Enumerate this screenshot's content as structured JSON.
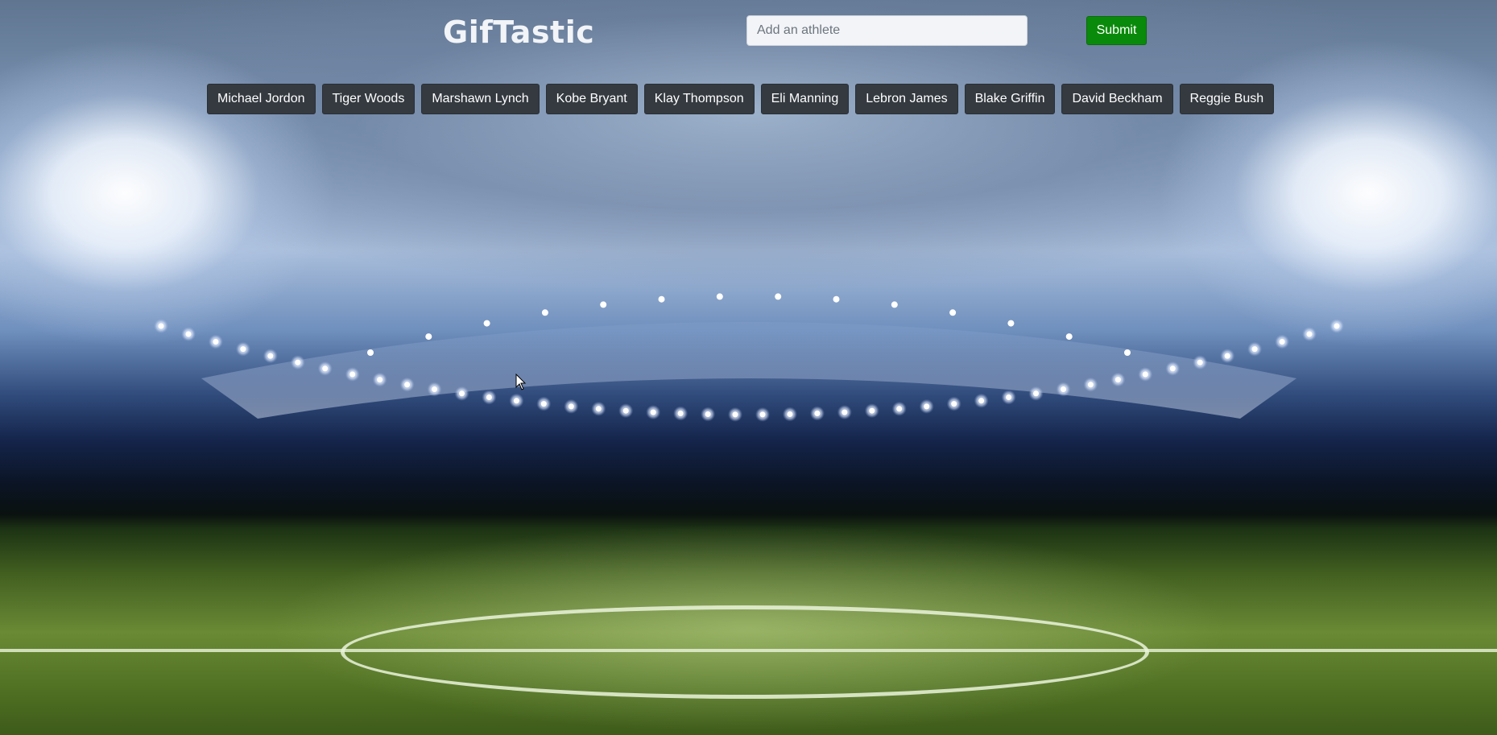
{
  "app": {
    "title": "GifTastic"
  },
  "search": {
    "placeholder": "Add an athlete",
    "value": "",
    "submit_label": "Submit"
  },
  "athletes": [
    {
      "label": "Michael Jordon"
    },
    {
      "label": "Tiger Woods"
    },
    {
      "label": "Marshawn Lynch"
    },
    {
      "label": "Kobe Bryant"
    },
    {
      "label": "Klay Thompson"
    },
    {
      "label": "Eli Manning"
    },
    {
      "label": "Lebron James"
    },
    {
      "label": "Blake Griffin"
    },
    {
      "label": "David Beckham"
    },
    {
      "label": "Reggie Bush"
    }
  ],
  "colors": {
    "submit_bg": "#0a8a0a",
    "athlete_button_bg": "#343a40",
    "title_color": "#f2f4f8"
  }
}
